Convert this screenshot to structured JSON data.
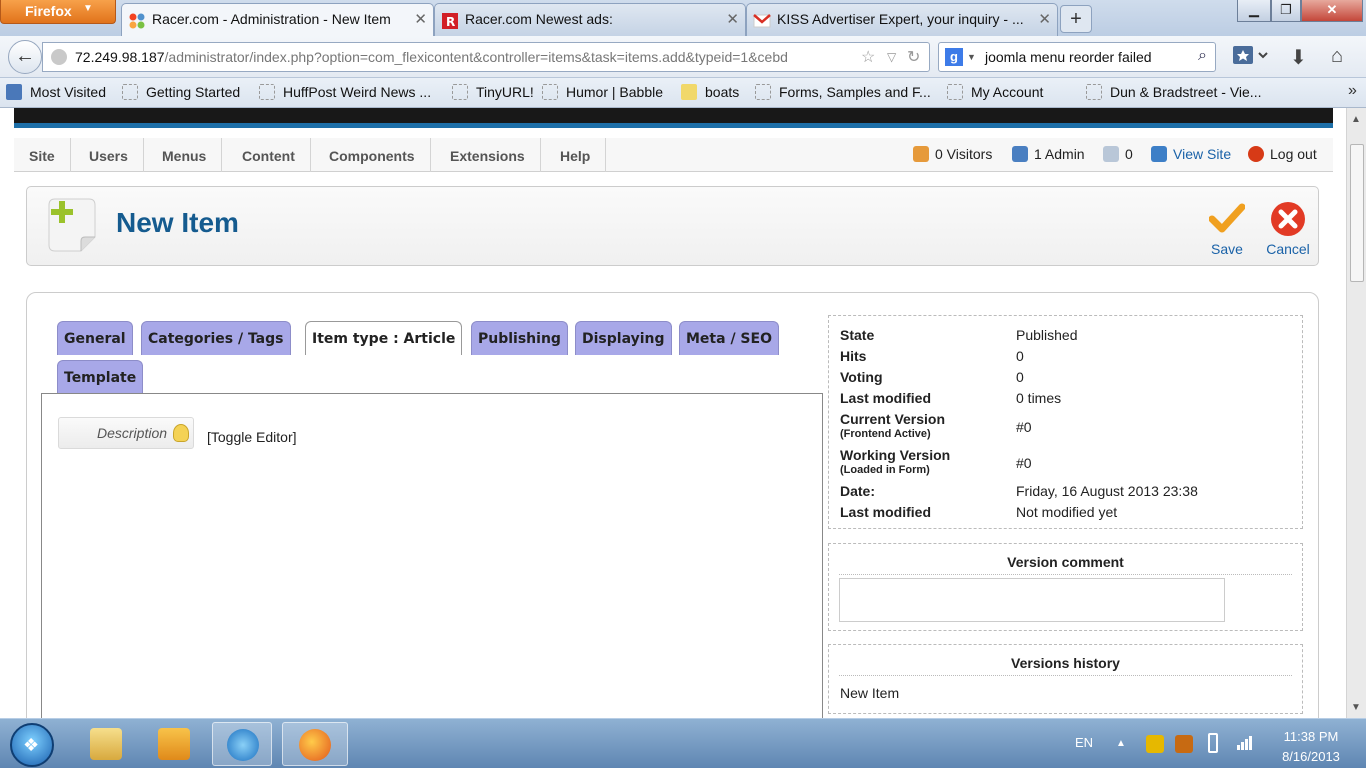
{
  "browser": {
    "app_button": "Firefox",
    "tabs": [
      {
        "label": "Racer.com - Administration - New Item"
      },
      {
        "label": "Racer.com Newest ads:"
      },
      {
        "label": "KISS Advertiser Expert, your inquiry - ..."
      }
    ],
    "url_host": "72.249.98.187",
    "url_path": "/administrator/index.php?option=com_flexicontent&controller=items&task=items.add&typeid=1&cebd",
    "search_value": "joomla menu reorder failed",
    "bookmarks": [
      {
        "label": "Most Visited"
      },
      {
        "label": "Getting Started"
      },
      {
        "label": "HuffPost Weird News ..."
      },
      {
        "label": "TinyURL!"
      },
      {
        "label": "Humor | Babble"
      },
      {
        "label": "boats"
      },
      {
        "label": "Forms, Samples and F..."
      },
      {
        "label": "My Account"
      },
      {
        "label": "Dun & Bradstreet - Vie..."
      }
    ]
  },
  "admin": {
    "menu": [
      "Site",
      "Users",
      "Menus",
      "Content",
      "Components",
      "Extensions",
      "Help"
    ],
    "status": {
      "visitors": "0 Visitors",
      "admins": "1 Admin",
      "messages": "0",
      "view_site": "View Site",
      "logout": "Log out"
    },
    "page_title": "New Item",
    "toolbar": {
      "save": "Save",
      "cancel": "Cancel"
    },
    "tabs": [
      "General",
      "Categories / Tags",
      "Item type : Article",
      "Publishing",
      "Displaying",
      "Meta / SEO",
      "Template"
    ],
    "active_tab": "Item type : Article",
    "description_label": "Description",
    "toggle_editor": "[Toggle Editor]",
    "info": [
      {
        "key": "State",
        "value": "Published"
      },
      {
        "key": "Hits",
        "value": "0"
      },
      {
        "key": "Voting",
        "value": "0"
      },
      {
        "key": "Last modified",
        "value": "0 times"
      },
      {
        "key": "Current Version",
        "sub": "(Frontend Active)",
        "value": "#0"
      },
      {
        "key": "Working Version",
        "sub": "(Loaded in Form)",
        "value": "#0"
      },
      {
        "key": "Date:",
        "value": "Friday, 16 August 2013 23:38"
      },
      {
        "key": "Last modified",
        "value": "Not modified yet"
      }
    ],
    "version_comment_title": "Version comment",
    "versions_history_title": "Versions history",
    "versions_history_item": "New Item"
  },
  "taskbar": {
    "language": "EN",
    "time": "11:38 PM",
    "date": "8/16/2013"
  },
  "colors": {
    "title_blue": "#155b8f",
    "tab_purple": "#a8a8e8",
    "link_blue": "#1a62a8",
    "cancel_red": "#e23a25",
    "save_orange": "#f0a020"
  }
}
